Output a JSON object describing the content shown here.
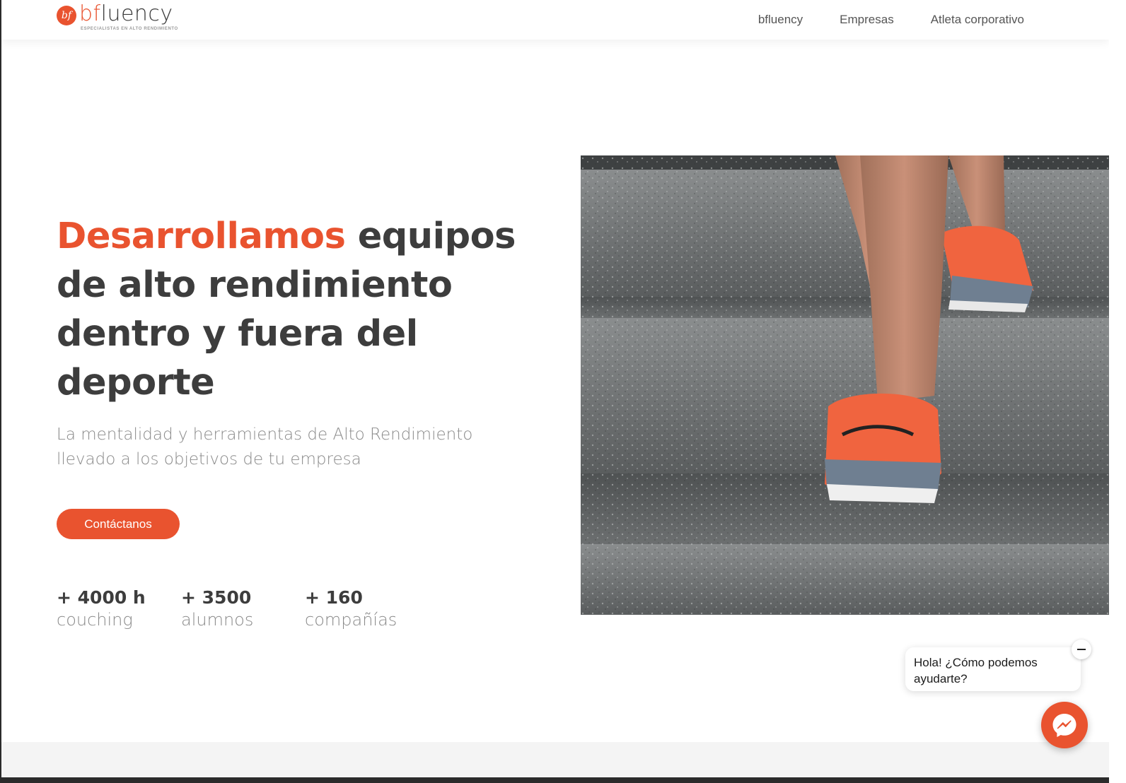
{
  "brand": {
    "logo_mark": "bf",
    "logo_word_prefix": "bf",
    "logo_word_rest": "luency",
    "tagline": "ESPECIALISTAS EN ALTO RENDIMIENTO",
    "accent_color": "#e9532f",
    "text_color": "#3d3d3d",
    "muted_color": "#8a8a8a"
  },
  "nav": {
    "items": [
      {
        "label": "bfluency"
      },
      {
        "label": "Empresas"
      },
      {
        "label": "Atleta corporativo"
      }
    ]
  },
  "hero": {
    "title_accent": "Desarrollamos",
    "title_rest": " equipos de alto rendimiento dentro y fuera del deporte",
    "subtitle": "La mentalidad y herramientas de Alto Rendimiento llevado a los objetivos de tu empresa",
    "cta_label": "Contáctanos",
    "image_icon": "running-shoes-stairs-photo"
  },
  "stats": [
    {
      "value": "+ 4000 h",
      "label": "couching"
    },
    {
      "value": "+ 3500",
      "label": "alumnos"
    },
    {
      "value": "+ 160",
      "label": "compañías"
    }
  ],
  "chat": {
    "greeting": "Hola! ¿Cómo podemos ayudarte?",
    "close_icon": "minus-icon",
    "launcher_icon": "messenger-icon"
  }
}
